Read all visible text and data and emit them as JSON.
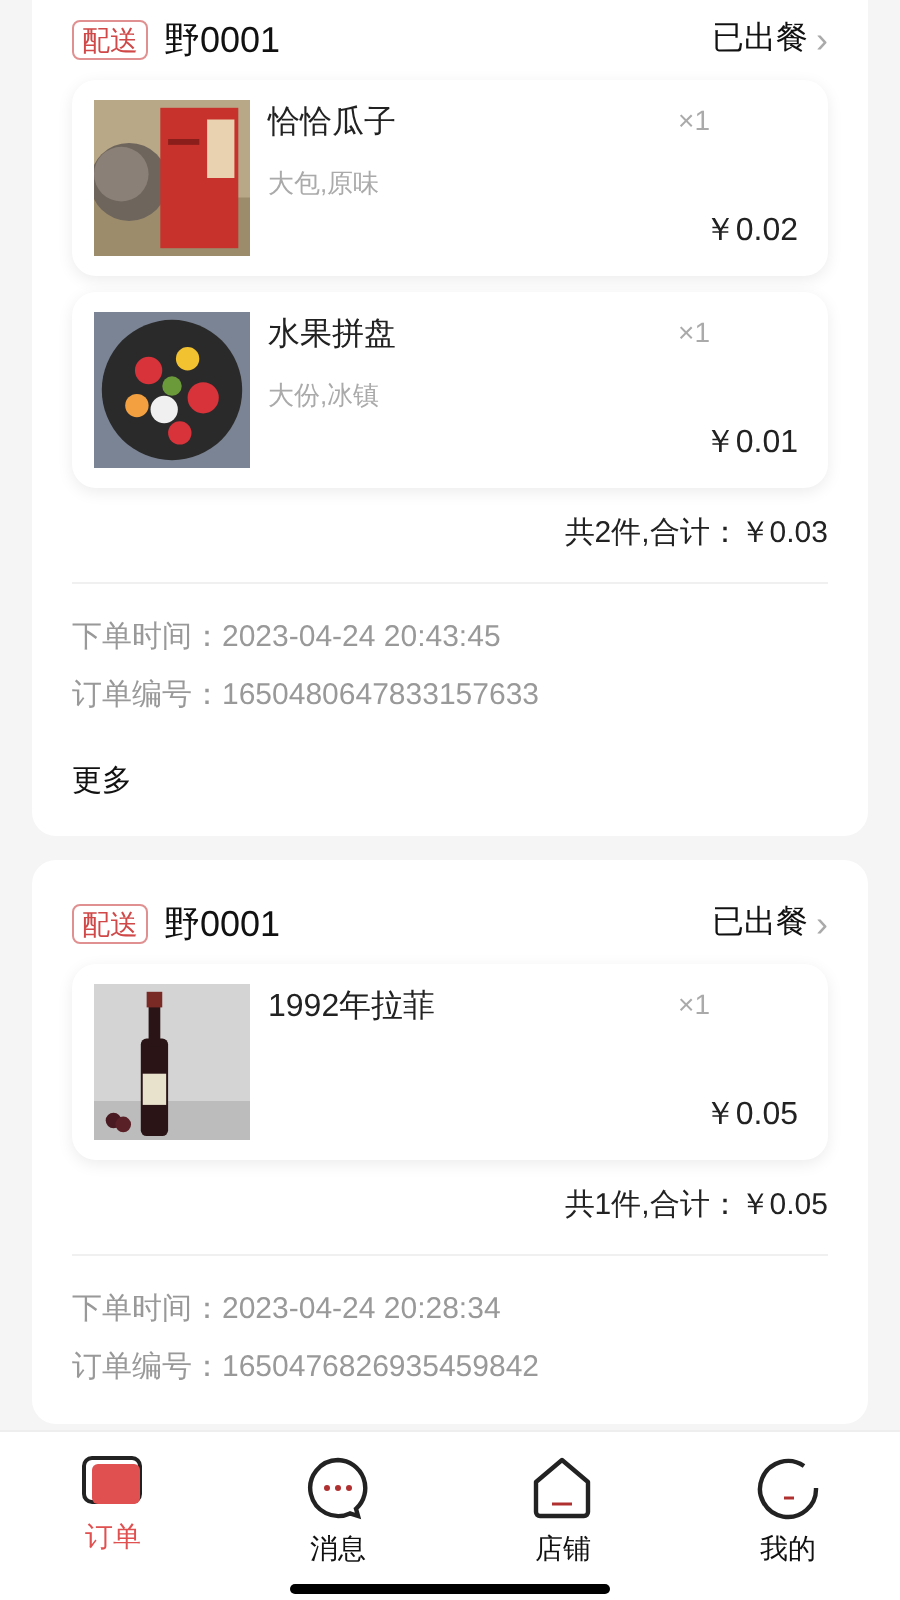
{
  "orders": [
    {
      "tag": "配送",
      "shop": "野0001",
      "status": "已出餐",
      "chevron": "›",
      "items": [
        {
          "name": "恰恰瓜子",
          "spec": "大包,原味",
          "qty": "×1",
          "price": "￥0.02",
          "kind": "picture"
        },
        {
          "name": "水果拼盘",
          "spec": "大份,冰镇",
          "qty": "×1",
          "price": "￥0.01",
          "kind": "picture"
        }
      ],
      "total": "共2件,合计：￥0.03",
      "time": "下单时间：2023-04-24 20:43:45",
      "number": "订单编号：1650480647833157633",
      "more": "更多"
    },
    {
      "tag": "配送",
      "shop": "野0001",
      "status": "已出餐",
      "chevron": "›",
      "items": [
        {
          "name": "1992年拉菲",
          "qty": "×1",
          "price": "￥0.05",
          "kind": "picture"
        }
      ],
      "total": "共1件,合计：￥0.05",
      "time": "下单时间：2023-04-24 20:28:34",
      "number": "订单编号：1650476826935459842"
    }
  ],
  "tabs": [
    {
      "label": "订单",
      "selected": true
    },
    {
      "label": "消息",
      "selected": false
    },
    {
      "label": "店铺",
      "selected": false
    },
    {
      "label": "我的",
      "selected": false
    }
  ]
}
